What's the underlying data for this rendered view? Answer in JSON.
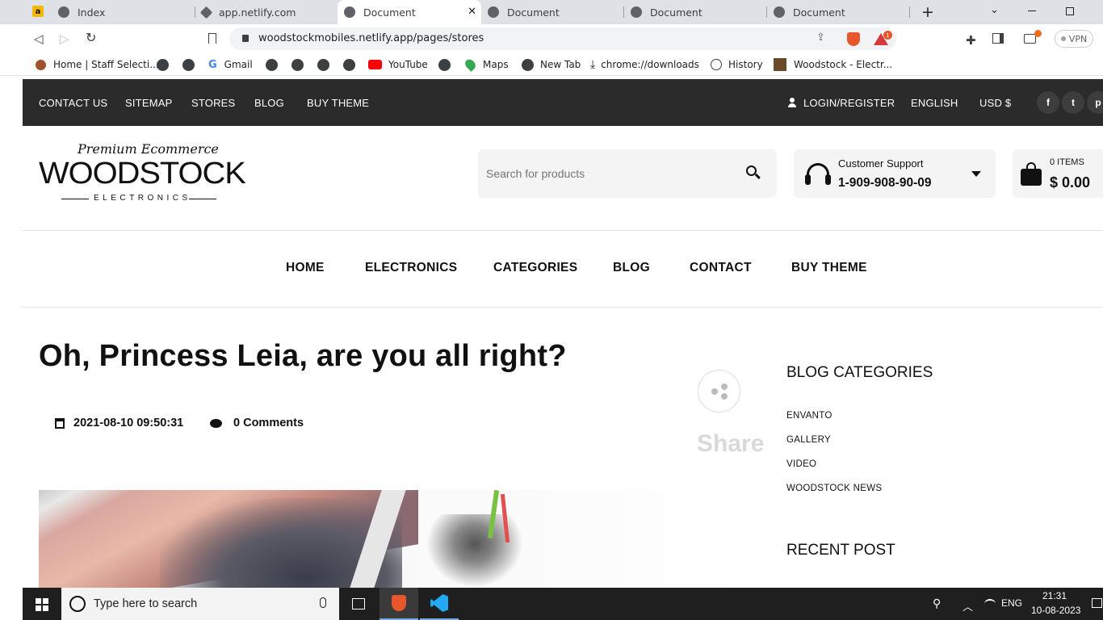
{
  "browser": {
    "tabs": [
      {
        "label": "Index",
        "active": false
      },
      {
        "label": "app.netlify.com",
        "active": false
      },
      {
        "label": "Document",
        "active": true
      },
      {
        "label": "Document",
        "active": false
      },
      {
        "label": "Document",
        "active": false
      },
      {
        "label": "Document",
        "active": false
      }
    ],
    "new_tab": "+",
    "url": "woodstockmobiles.netlify.app/pages/stores",
    "vpn": "VPN",
    "brave_badge": "1",
    "bookmarks": [
      "Home | Staff Selecti...",
      "Gmail",
      "YouTube",
      "Maps",
      "New Tab",
      "chrome://downloads",
      "History",
      "Woodstock - Electr..."
    ]
  },
  "topbar": {
    "links": [
      "CONTACT US",
      "SITEMAP",
      "STORES",
      "BLOG",
      "BUY THEME"
    ],
    "login": "LOGIN/REGISTER",
    "language": "ENGLISH",
    "currency": "USD $",
    "social": [
      "f",
      "t",
      "p"
    ]
  },
  "header": {
    "logo_tagline": "Premium Ecommerce",
    "logo_name": "WOODSTOCK",
    "logo_sub": "ELECTRONICS",
    "search_placeholder": "Search for products",
    "support_label": "Customer Support",
    "support_phone": "1-909-908-90-09",
    "cart_items": "0 ITEMS",
    "cart_total": "$ 0.00"
  },
  "nav": [
    "HOME",
    "ELECTRONICS",
    "CATEGORIES",
    "BLOG",
    "CONTACT",
    "BUY THEME"
  ],
  "post": {
    "title": "Oh, Princess Leia, are you all right?",
    "date": "2021-08-10 09:50:31",
    "comments": "0 Comments",
    "share": "Share"
  },
  "sidebar": {
    "categories_title": "BLOG CATEGORIES",
    "categories": [
      "ENVANTO",
      "GALLERY",
      "VIDEO",
      "WOODSTOCK NEWS"
    ],
    "recent_title": "RECENT POST"
  },
  "taskbar": {
    "search_placeholder": "Type here to search",
    "language": "ENG",
    "time": "21:31",
    "date": "10-08-2023"
  },
  "colors": {
    "topbar": "#2b2b2b",
    "taskbar": "#1f1f1f",
    "accent": "#111111"
  }
}
